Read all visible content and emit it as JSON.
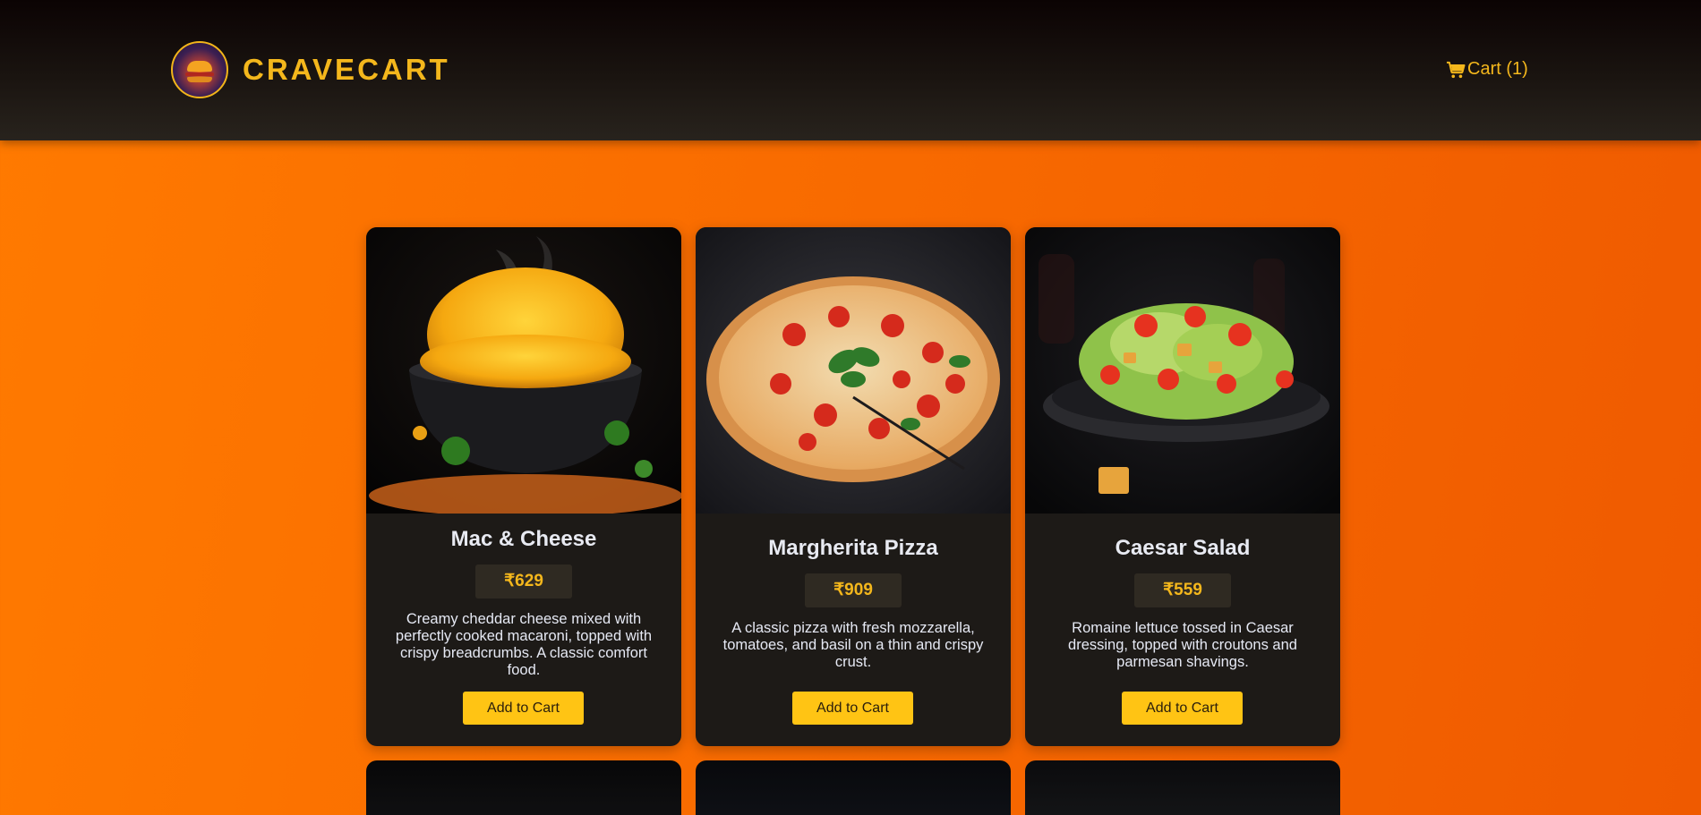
{
  "header": {
    "brand": "CRAVECART",
    "cart_label": "Cart (1)"
  },
  "products": [
    {
      "title": "Mac & Cheese",
      "price": "₹629",
      "description": "Creamy cheddar cheese mixed with perfectly cooked macaroni, topped with crispy breadcrumbs. A classic comfort food.",
      "button": "Add to Cart"
    },
    {
      "title": "Margherita Pizza",
      "price": "₹909",
      "description": "A classic pizza with fresh mozzarella, tomatoes, and basil on a thin and crispy crust.",
      "button": "Add to Cart"
    },
    {
      "title": "Caesar Salad",
      "price": "₹559",
      "description": "Romaine lettuce tossed in Caesar dressing, topped with croutons and parmesan shavings.",
      "button": "Add to Cart"
    }
  ],
  "colors": {
    "accent": "#f4b71c",
    "button": "#ffc414",
    "card_bg": "#1d1a17",
    "background_start": "#ff7a00",
    "background_end": "#ef5a00"
  },
  "icons": {
    "cart": "shopping-cart-icon",
    "logo": "burger-logo-icon"
  }
}
